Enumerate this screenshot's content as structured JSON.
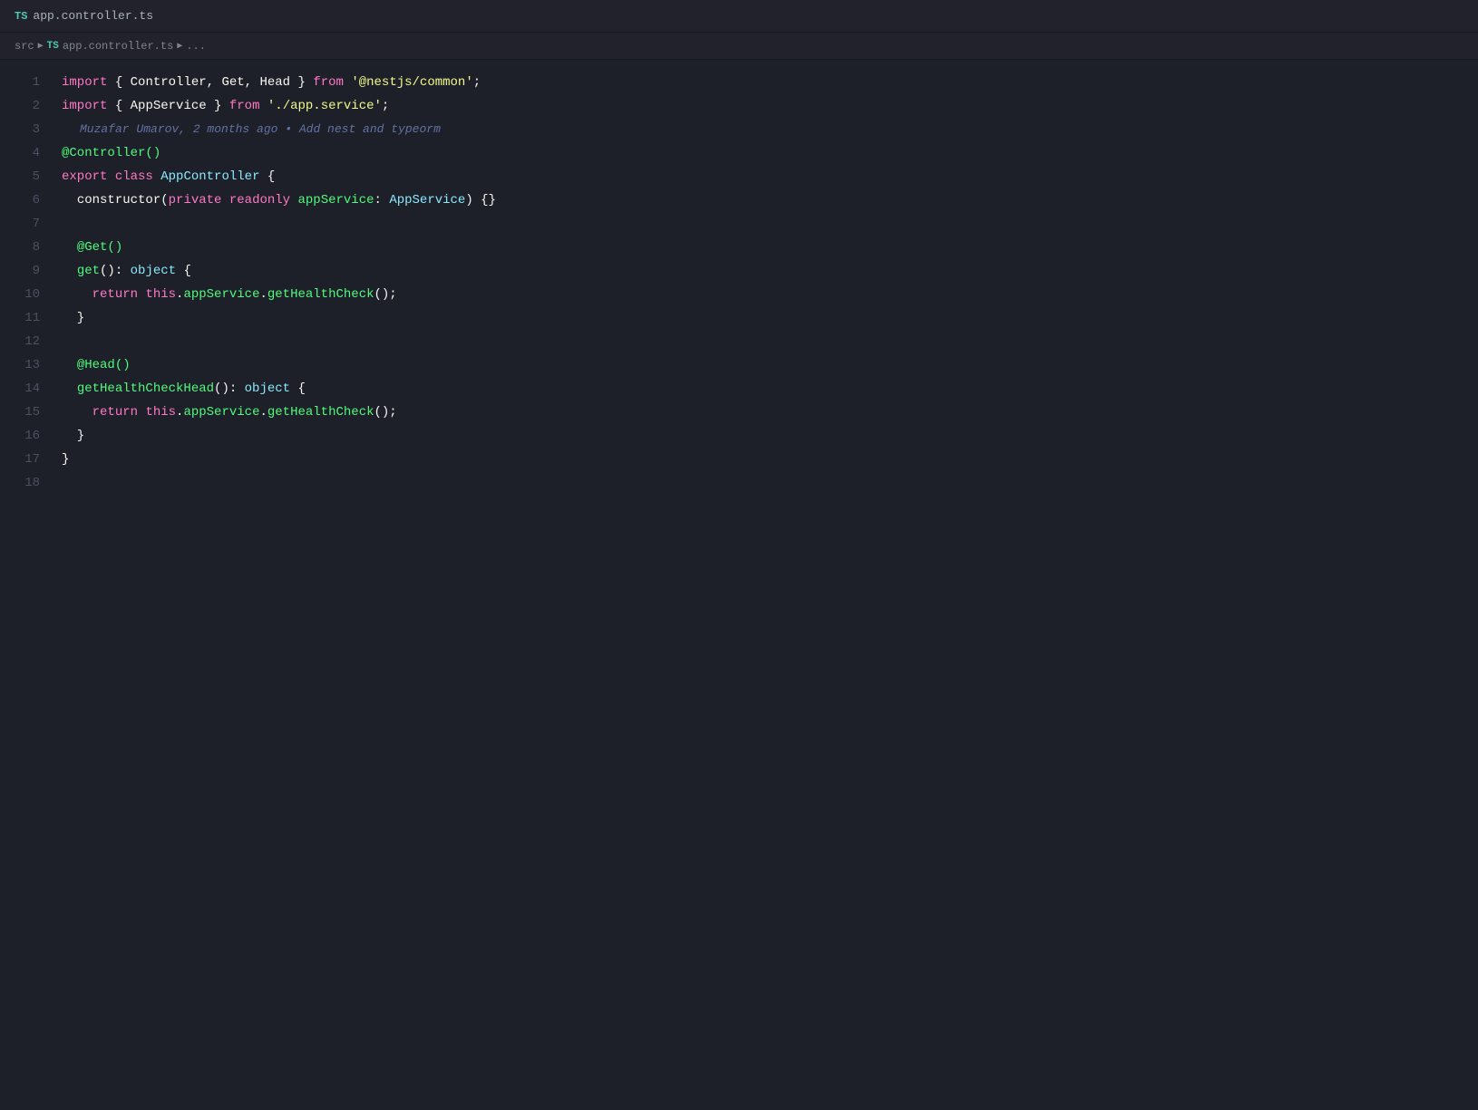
{
  "titleBar": {
    "tsBadge": "TS",
    "filename": "app.controller.ts"
  },
  "breadcrumb": {
    "items": [
      {
        "label": "src",
        "type": "text"
      },
      {
        "label": "▶",
        "type": "separator"
      },
      {
        "tsBadge": "TS",
        "label": "app.controller.ts",
        "type": "file"
      },
      {
        "label": "▶",
        "type": "separator"
      },
      {
        "label": "...",
        "type": "text"
      }
    ]
  },
  "lineNumbers": [
    1,
    2,
    3,
    4,
    5,
    6,
    7,
    8,
    9,
    10,
    11,
    12,
    13,
    14,
    15,
    16,
    17,
    18
  ],
  "gitAnnotation": {
    "line": 3,
    "text": "Muzafar Umarov, 2 months ago • Add nest and typeorm"
  },
  "code": {
    "lines": [
      {
        "num": 1,
        "tokens": [
          {
            "t": "kw-import",
            "v": "import"
          },
          {
            "t": "normal",
            "v": " { "
          },
          {
            "t": "normal",
            "v": "Controller, Get, Head"
          },
          {
            "t": "normal",
            "v": " } "
          },
          {
            "t": "kw-from",
            "v": "from"
          },
          {
            "t": "normal",
            "v": " "
          },
          {
            "t": "string",
            "v": "'@nestjs/common'"
          },
          {
            "t": "normal",
            "v": ";"
          }
        ]
      },
      {
        "num": 2,
        "tokens": [
          {
            "t": "kw-import",
            "v": "import"
          },
          {
            "t": "normal",
            "v": " { "
          },
          {
            "t": "normal",
            "v": "AppService"
          },
          {
            "t": "normal",
            "v": " } "
          },
          {
            "t": "kw-from",
            "v": "from"
          },
          {
            "t": "normal",
            "v": " "
          },
          {
            "t": "string",
            "v": "'./app.service'"
          },
          {
            "t": "normal",
            "v": ";"
          }
        ]
      },
      {
        "num": 3,
        "tokens": [],
        "gitAnnotation": true
      },
      {
        "num": 4,
        "tokens": [
          {
            "t": "decorator",
            "v": "@Controller()"
          }
        ]
      },
      {
        "num": 5,
        "tokens": [
          {
            "t": "kw-export",
            "v": "export"
          },
          {
            "t": "normal",
            "v": " "
          },
          {
            "t": "kw-class",
            "v": "class"
          },
          {
            "t": "normal",
            "v": " "
          },
          {
            "t": "class-name",
            "v": "AppController"
          },
          {
            "t": "normal",
            "v": " {"
          }
        ]
      },
      {
        "num": 6,
        "tokens": [
          {
            "t": "normal",
            "v": "  "
          },
          {
            "t": "normal",
            "v": "constructor("
          },
          {
            "t": "kw-private",
            "v": "private"
          },
          {
            "t": "normal",
            "v": " "
          },
          {
            "t": "kw-readonly",
            "v": "readonly"
          },
          {
            "t": "normal",
            "v": " "
          },
          {
            "t": "property",
            "v": "appService"
          },
          {
            "t": "normal",
            "v": ": "
          },
          {
            "t": "class-name",
            "v": "AppService"
          },
          {
            "t": "normal",
            "v": ") {}"
          }
        ]
      },
      {
        "num": 7,
        "tokens": []
      },
      {
        "num": 8,
        "tokens": [
          {
            "t": "normal",
            "v": "  "
          },
          {
            "t": "decorator",
            "v": "@Get()"
          }
        ]
      },
      {
        "num": 9,
        "tokens": [
          {
            "t": "normal",
            "v": "  "
          },
          {
            "t": "method-name",
            "v": "get"
          },
          {
            "t": "normal",
            "v": "(): "
          },
          {
            "t": "kw-object",
            "v": "object"
          },
          {
            "t": "normal",
            "v": " {"
          }
        ]
      },
      {
        "num": 10,
        "tokens": [
          {
            "t": "normal",
            "v": "    "
          },
          {
            "t": "kw-return",
            "v": "return"
          },
          {
            "t": "normal",
            "v": " "
          },
          {
            "t": "this-kw",
            "v": "this"
          },
          {
            "t": "normal",
            "v": "."
          },
          {
            "t": "property",
            "v": "appService"
          },
          {
            "t": "normal",
            "v": "."
          },
          {
            "t": "method-name",
            "v": "getHealthCheck"
          },
          {
            "t": "normal",
            "v": "();"
          }
        ]
      },
      {
        "num": 11,
        "tokens": [
          {
            "t": "normal",
            "v": "  }"
          }
        ]
      },
      {
        "num": 12,
        "tokens": []
      },
      {
        "num": 13,
        "tokens": [
          {
            "t": "normal",
            "v": "  "
          },
          {
            "t": "decorator",
            "v": "@Head()"
          }
        ]
      },
      {
        "num": 14,
        "tokens": [
          {
            "t": "normal",
            "v": "  "
          },
          {
            "t": "method-name",
            "v": "getHealthCheckHead"
          },
          {
            "t": "normal",
            "v": "(): "
          },
          {
            "t": "kw-object",
            "v": "object"
          },
          {
            "t": "normal",
            "v": " {"
          }
        ]
      },
      {
        "num": 15,
        "tokens": [
          {
            "t": "normal",
            "v": "    "
          },
          {
            "t": "kw-return",
            "v": "return"
          },
          {
            "t": "normal",
            "v": " "
          },
          {
            "t": "this-kw",
            "v": "this"
          },
          {
            "t": "normal",
            "v": "."
          },
          {
            "t": "property",
            "v": "appService"
          },
          {
            "t": "normal",
            "v": "."
          },
          {
            "t": "method-name",
            "v": "getHealthCheck"
          },
          {
            "t": "normal",
            "v": "();"
          }
        ]
      },
      {
        "num": 16,
        "tokens": [
          {
            "t": "normal",
            "v": "  }"
          }
        ]
      },
      {
        "num": 17,
        "tokens": [
          {
            "t": "normal",
            "v": "}"
          }
        ]
      },
      {
        "num": 18,
        "tokens": []
      }
    ]
  }
}
